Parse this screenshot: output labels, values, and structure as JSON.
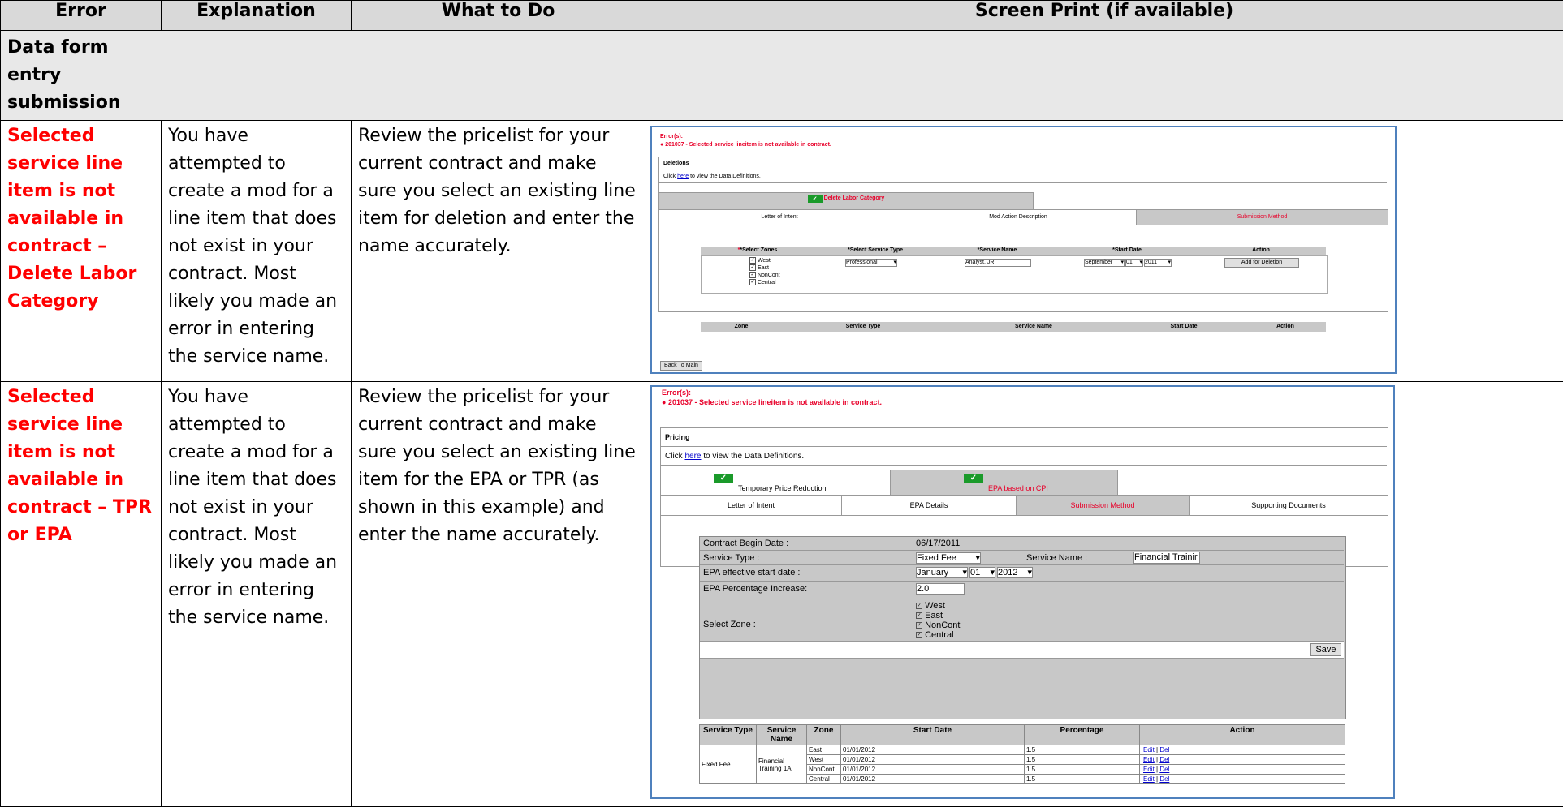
{
  "headers": {
    "error": "Error",
    "explanation": "Explanation",
    "what_to_do": "What to Do",
    "screen_print": "Screen Print (if available)"
  },
  "section_title": "Data form entry submission",
  "rows": [
    {
      "error": "Selected service line item is not available in contract – Delete Labor Category",
      "explanation": "You have attempted to create a mod for a line item that does not exist in your contract.  Most likely you made an error in entering the service name.",
      "what_to_do": "Review the pricelist for your current contract and make sure you select an existing line item for deletion and enter the name accurately."
    },
    {
      "error": "Selected service line item is not available in contract – TPR or EPA",
      "explanation": "You have attempted to create a mod for a line item that does not exist in your contract.  Most likely you made an error in entering the service name.",
      "what_to_do": "Review the pricelist for your current contract and make sure you select an existing line item for the EPA or TPR (as shown in this example) and enter the name accurately."
    }
  ],
  "shot1": {
    "errors_label": "Error(s):",
    "error_msg": "201037 - Selected service lineitem is not available in contract.",
    "section": "Deletions",
    "click_pre": "Click ",
    "click_link": "here",
    "click_post": " to view the Data Definitions.",
    "top_tab": "Delete Labor Category",
    "tabs": [
      "Letter of Intent",
      "Mod Action Description",
      "Submission Method"
    ],
    "form_headers": [
      "*Select Zones",
      "*Select Service Type",
      "*Service Name",
      "*Start Date",
      "Action"
    ],
    "zones": [
      "West",
      "East",
      "NonCont",
      "Central"
    ],
    "service_type": "Professional",
    "service_name": "Analyst, JR",
    "start_month": "September",
    "start_day": "01",
    "start_year": "2011",
    "add_btn": "Add for Deletion",
    "list_headers": [
      "Zone",
      "Service Type",
      "Service Name",
      "Start Date",
      "Action"
    ],
    "back_btn": "Back To Main"
  },
  "shot2": {
    "errors_label": "Error(s):",
    "error_msg": "201037 - Selected service lineitem is not available in contract.",
    "section": "Pricing",
    "click_pre": "Click ",
    "click_link": "here",
    "click_post": " to view the Data Definitions.",
    "top_tabs": [
      "Temporary Price Reduction",
      "EPA based on CPI"
    ],
    "tabs": [
      "Letter of Intent",
      "EPA Details",
      "Submission Method",
      "Supporting Documents"
    ],
    "fields": {
      "contract_begin_label": "Contract Begin Date :",
      "contract_begin_value": "06/17/2011",
      "service_type_label": "Service Type :",
      "service_type_value": "Fixed Fee",
      "service_name_label": "Service Name :",
      "service_name_value": "Financial Trainir",
      "epa_start_label": "EPA effective start date :",
      "epa_month": "January",
      "epa_day": "01",
      "epa_year": "2012",
      "epa_pct_label": "EPA Percentage Increase:",
      "epa_pct_value": "2.0",
      "zone_label": "Select Zone :"
    },
    "zones": [
      "West",
      "East",
      "NonCont",
      "Central"
    ],
    "save_btn": "Save",
    "table_headers": [
      "Service Type",
      "Service Name",
      "Zone",
      "Start Date",
      "Percentage",
      "Action"
    ],
    "service_type": "Fixed Fee",
    "service_name": "Financial Training 1A",
    "table_rows": [
      {
        "zone": "East",
        "date": "01/01/2012",
        "pct": "1.5"
      },
      {
        "zone": "West",
        "date": "01/01/2012",
        "pct": "1.5"
      },
      {
        "zone": "NonCont",
        "date": "01/01/2012",
        "pct": "1.5"
      },
      {
        "zone": "Central",
        "date": "01/01/2012",
        "pct": "1.5"
      }
    ],
    "edit": "Edit",
    "del": "Del",
    "sep": " | "
  }
}
